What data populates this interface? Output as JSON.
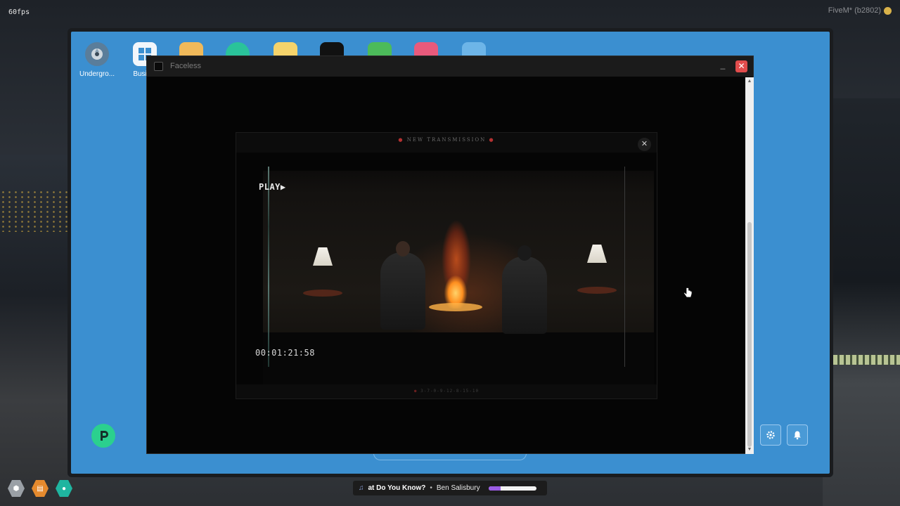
{
  "hud": {
    "fps": "60fps",
    "build": "FiveM* (b2802)"
  },
  "desktop": {
    "icons": [
      {
        "label": "Undergro...",
        "icon": "turbo-icon",
        "color": "#5a7d9a"
      },
      {
        "label": "Busin...",
        "icon": "grid-icon",
        "color": "#f2f6fb"
      },
      {
        "label": "",
        "icon": "folder-icon",
        "color": "#f0b95a"
      },
      {
        "label": "",
        "icon": "sticker-icon",
        "color": "#2ac39a"
      },
      {
        "label": "",
        "icon": "notes-icon",
        "color": "#f5d36b"
      },
      {
        "label": "",
        "icon": "faceless-icon",
        "color": "#111111"
      },
      {
        "label": "",
        "icon": "money-icon",
        "color": "#4cbb5a"
      },
      {
        "label": "",
        "icon": "house-icon",
        "color": "#e85a7c"
      },
      {
        "label": "",
        "icon": "mail-icon",
        "color": "#6db5e8"
      }
    ],
    "accent": "#3b8fd0",
    "tray": {
      "settings_icon": "gear-icon",
      "notification_icon": "bell-icon"
    }
  },
  "window": {
    "title": "Faceless",
    "minimize_label": "_",
    "close_label": "✕"
  },
  "modal": {
    "header": "NEW TRANSMISSION",
    "close_label": "✕",
    "footer_code": "3-7-0-9-12-8-15-10",
    "video": {
      "play_label": "PLAY▶",
      "timecode": "00:01:21:58"
    }
  },
  "music": {
    "song": "at Do You Know?",
    "separator": "•",
    "artist": "Ben Salisbury",
    "progress": 0.25,
    "progress_color": "#9b5de5"
  },
  "hud_icons": [
    {
      "icon": "shield-icon",
      "color": "#9aa0a6"
    },
    {
      "icon": "food-icon",
      "color": "#e58a2e"
    },
    {
      "icon": "water-icon",
      "color": "#1fb5a0"
    }
  ]
}
